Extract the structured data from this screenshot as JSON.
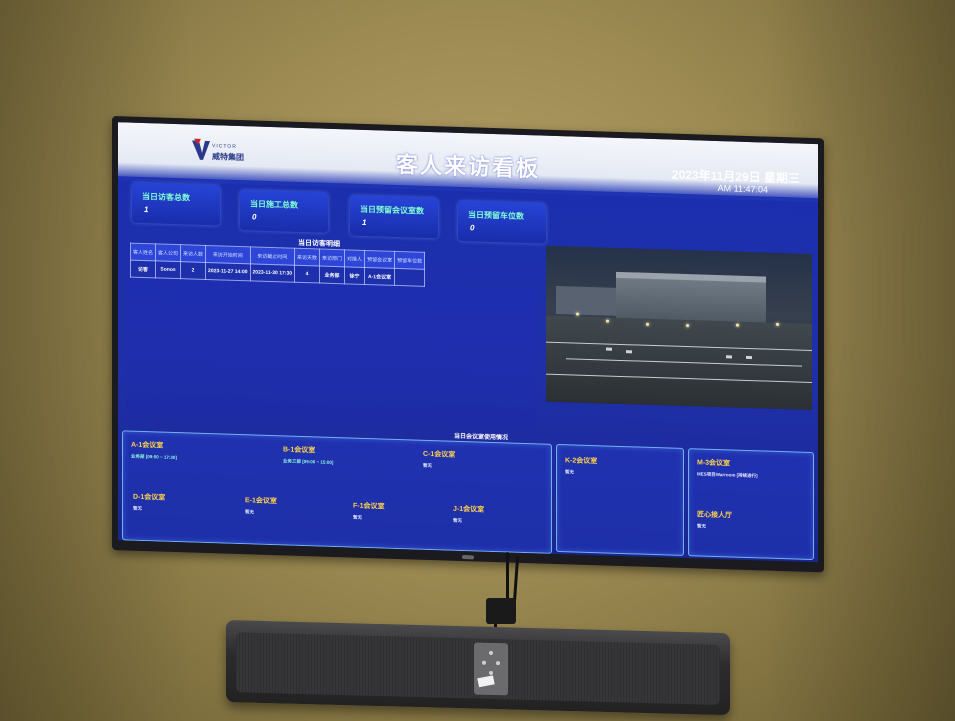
{
  "header": {
    "logo_small": "VICTOR",
    "logo_cn": "威特集团",
    "title": "客人来访看板",
    "date": "2023年11月29日 星期三",
    "time": "AM 11:47:04"
  },
  "stats": [
    {
      "label": "当日访客总数",
      "value": "1"
    },
    {
      "label": "当日施工总数",
      "value": "0"
    },
    {
      "label": "当日预留会议室数",
      "value": "1"
    },
    {
      "label": "当日预留车位数",
      "value": "0"
    }
  ],
  "visitors": {
    "title": "当日访客明细",
    "headers": [
      "客人姓名",
      "客人公司",
      "来访人数",
      "来访开始时间",
      "来访截止时间",
      "来访天数",
      "来访部门",
      "对接人",
      "预留会议室",
      "预留车位数"
    ],
    "rows": [
      [
        "访客",
        "Sonos",
        "2",
        "2023-11-27 14:00",
        "2023-11-30 17:30",
        "4",
        "业务部",
        "徐宁",
        "A-1会议室",
        ""
      ]
    ]
  },
  "rooms": {
    "title": "当日会议室使用情况",
    "items": [
      {
        "name": "A-1会议室",
        "info": "业务部 [09:00 ~ 17:30]"
      },
      {
        "name": "B-1会议室",
        "info": "业务三部 [09:00 ~ 15:00]"
      },
      {
        "name": "C-1会议室",
        "info": "暂无"
      },
      {
        "name": "D-1会议室",
        "info": "暂无"
      },
      {
        "name": "E-1会议室",
        "info": "暂无"
      },
      {
        "name": "F-1会议室",
        "info": "暂无"
      },
      {
        "name": "J-1会议室",
        "info": "暂无"
      },
      {
        "name": "K-2会议室",
        "info": "暂无"
      },
      {
        "name": "M-3会议室",
        "info": "MES项目Warroom [持续进行]"
      },
      {
        "name": "匠心接人厅",
        "info": "暂无"
      }
    ]
  }
}
